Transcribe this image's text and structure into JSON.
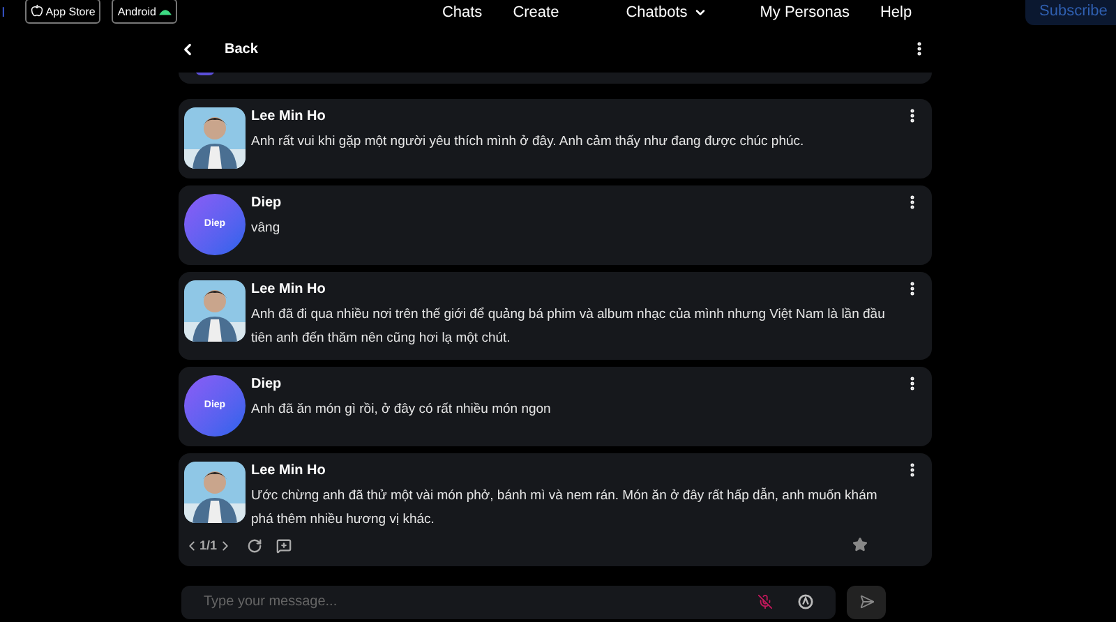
{
  "topbar": {
    "logo": "I",
    "badges": [
      {
        "kind": "apple",
        "label": "App Store"
      },
      {
        "kind": "android",
        "label": "Android"
      }
    ],
    "nav": [
      {
        "label": "Chats",
        "dropdown": false
      },
      {
        "label": "Create",
        "dropdown": false
      },
      {
        "label": "Chatbots",
        "dropdown": true
      },
      {
        "label": "My Personas",
        "dropdown": false
      },
      {
        "label": "Help",
        "dropdown": false
      }
    ],
    "subscribe": "Subscribe"
  },
  "header": {
    "back": "Back"
  },
  "messages": [
    {
      "kind": "bot",
      "name": "Lee Min Ho",
      "text": "Anh rất vui khi gặp một người yêu thích mình ở đây. Anh cảm thấy như đang được chúc phúc."
    },
    {
      "kind": "user",
      "name": "Diep",
      "avatar": "Diep",
      "text": "vâng"
    },
    {
      "kind": "bot",
      "name": "Lee Min Ho",
      "text": "Anh đã đi qua nhiều nơi trên thế giới để quảng bá phim và album nhạc của mình nhưng Việt Nam là lần đầu tiên anh đến thăm nên cũng hơi lạ một chút."
    },
    {
      "kind": "user",
      "name": "Diep",
      "avatar": "Diep",
      "text": "Anh đã ăn món gì rồi, ở đây có rất nhiều món ngon"
    },
    {
      "kind": "bot",
      "name": "Lee Min Ho",
      "text": "Ước chừng anh đã thử một vài món phở, bánh mì và nem rán. Món ăn ở đây rất hấp dẫn, anh muốn khám phá thêm nhiều hương vị khác.",
      "pager": "1/1"
    }
  ],
  "composer": {
    "placeholder": "Type your message..."
  }
}
